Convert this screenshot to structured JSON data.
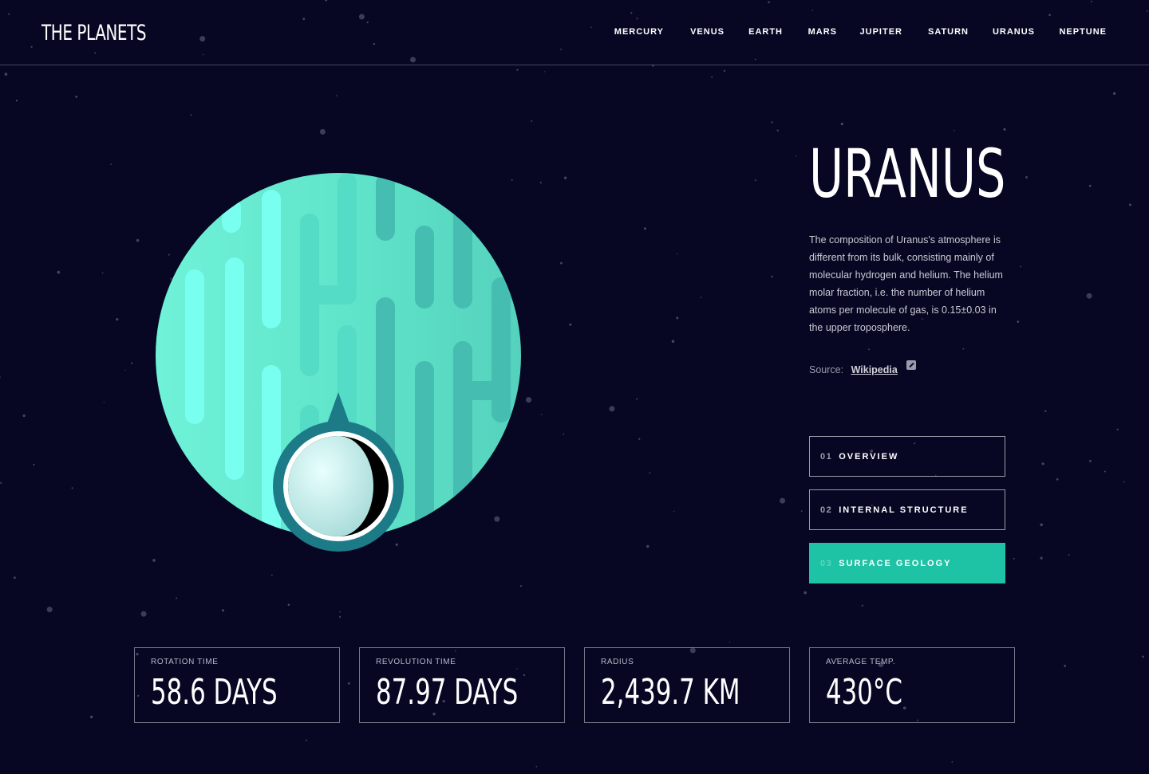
{
  "app": {
    "logo": "THE PLANETS"
  },
  "nav": {
    "items": [
      "MERCURY",
      "VENUS",
      "EARTH",
      "MARS",
      "JUPITER",
      "SATURN",
      "URANUS",
      "NEPTUNE"
    ]
  },
  "planet": {
    "name": "URANUS",
    "description": "The composition of Uranus's atmosphere is different from its bulk, consisting mainly of molecular hydrogen and helium. The helium molar fraction, i.e. the number of helium atoms per molecule of gas, is 0.15±0.03 in the upper troposphere.",
    "source_label": "Source:",
    "source_link": "Wikipedia"
  },
  "tabs": [
    {
      "num": "01",
      "label": "OVERVIEW",
      "active": false
    },
    {
      "num": "02",
      "label": "INTERNAL STRUCTURE",
      "active": false
    },
    {
      "num": "03",
      "label": "SURFACE GEOLOGY",
      "active": true
    }
  ],
  "stats": [
    {
      "label": "ROTATION TIME",
      "value": "58.6 DAYS"
    },
    {
      "label": "REVOLUTION TIME",
      "value": "87.97 DAYS"
    },
    {
      "label": "RADIUS",
      "value": "2,439.7 KM"
    },
    {
      "label": "AVERAGE TEMP.",
      "value": "430°C"
    }
  ],
  "colors": {
    "background": "#070724",
    "accent": "#1ec2a4",
    "planet_base": "#65f0d5"
  },
  "icons": {
    "external_link": "external-link-icon"
  }
}
